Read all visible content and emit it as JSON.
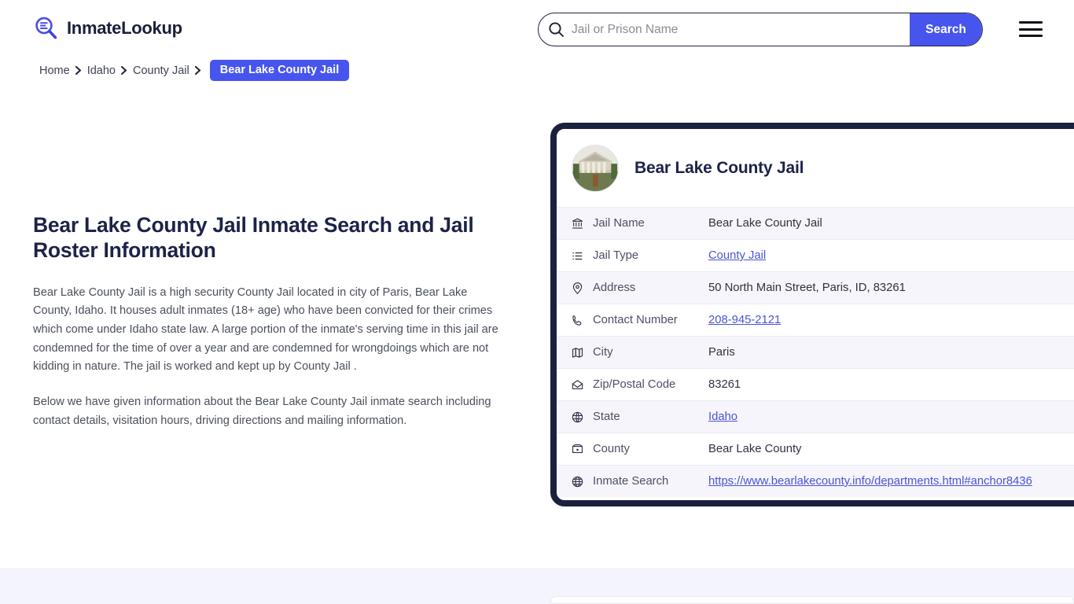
{
  "site": {
    "brand_name": "InmateLookup",
    "logo_icon": "magnifier-lines-icon"
  },
  "search": {
    "placeholder": "Jail or Prison Name",
    "value": "",
    "button_label": "Search",
    "icon": "search-icon"
  },
  "menu": {
    "icon": "hamburger-menu-icon"
  },
  "breadcrumb": {
    "items": [
      {
        "label": "Home",
        "active": false
      },
      {
        "label": "Idaho",
        "active": false
      },
      {
        "label": "County Jail",
        "active": false
      },
      {
        "label": "Bear Lake County Jail",
        "active": true
      }
    ],
    "separator": "›"
  },
  "main": {
    "title": "Bear Lake County Jail Inmate Search and Jail Roster Information",
    "paragraph_1": "Bear Lake County Jail is a high security County Jail located in city of Paris, Bear Lake County, Idaho. It houses adult inmates (18+ age) who have been convicted for their crimes which come under Idaho state law. A large portion of the inmate's serving time in this jail are condemned for the time of over a year and are condemned for wrongdoings which are not kidding in nature. The jail is worked and kept up by County Jail .",
    "paragraph_2": "Below we have given information about the Bear Lake County Jail inmate search including contact details, visitation hours, driving directions and mailing information."
  },
  "card": {
    "thumbnail_icon": "courthouse-photo",
    "title": "Bear Lake County Jail",
    "rows": [
      {
        "icon": "bank-icon",
        "label": "Jail Name",
        "value": "Bear Lake County Jail",
        "link": false
      },
      {
        "icon": "list-icon",
        "label": "Jail Type",
        "value": "County Jail",
        "link": true
      },
      {
        "icon": "map-pin-icon",
        "label": "Address",
        "value": "50 North Main Street, Paris, ID, 83261",
        "link": false
      },
      {
        "icon": "phone-icon",
        "label": "Contact Number",
        "value": "208-945-2121",
        "link": true
      },
      {
        "icon": "map-icon",
        "label": "City",
        "value": "Paris",
        "link": false
      },
      {
        "icon": "envelope-icon",
        "label": "Zip/Postal Code",
        "value": "83261",
        "link": false
      },
      {
        "icon": "globe-grid-icon",
        "label": "State",
        "value": "Idaho",
        "link": true
      },
      {
        "icon": "county-icon",
        "label": "County",
        "value": "Bear Lake County",
        "link": false
      },
      {
        "icon": "world-icon",
        "label": "Inmate Search",
        "value": "https://www.bearlakecounty.info/departments.html#anchor8436",
        "link": true
      }
    ]
  },
  "colors": {
    "accent_blue": "#4755EE",
    "navy": "#1b203e",
    "link_blue": "#4a54d2",
    "row_alt_bg": "#f6f5fc",
    "band_bg": "#f4f4fd"
  }
}
